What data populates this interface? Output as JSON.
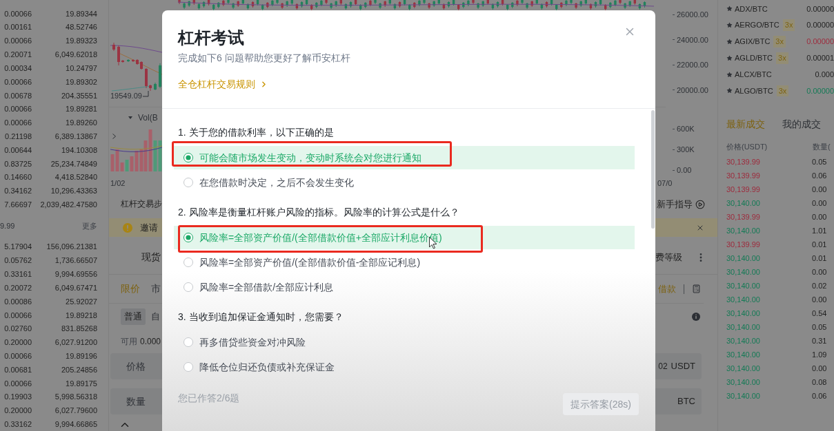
{
  "order_book": {
    "asks": [
      {
        "amount": "0.00066",
        "total": "19.89344"
      },
      {
        "amount": "0.00161",
        "total": "48.52746"
      },
      {
        "amount": "0.00066",
        "total": "19.89323"
      },
      {
        "amount": "0.20071",
        "total": "6,049.62018"
      },
      {
        "amount": "0.00034",
        "total": "10.24797"
      },
      {
        "amount": "0.00066",
        "total": "19.89302"
      },
      {
        "amount": "0.00678",
        "total": "204.35551"
      },
      {
        "amount": "0.00066",
        "total": "19.89281"
      },
      {
        "amount": "0.00066",
        "total": "19.89260"
      },
      {
        "amount": "0.21198",
        "total": "6,389.13867"
      },
      {
        "amount": "0.00644",
        "total": "194.10308"
      },
      {
        "amount": "0.83725",
        "total": "25,234.74849"
      },
      {
        "amount": "0.14660",
        "total": "4,418.52840"
      },
      {
        "amount": "0.34162",
        "total": "10,296.43363"
      },
      {
        "amount": "7.66697",
        "total": "2,039,482.47580"
      }
    ],
    "mid": {
      "price": "9.99",
      "more": "更多"
    },
    "bids": [
      {
        "amount": "5.17904",
        "total": "156,096.21381"
      },
      {
        "amount": "0.05762",
        "total": "1,736.66507"
      },
      {
        "amount": "0.33161",
        "total": "9,994.69556"
      },
      {
        "amount": "0.20072",
        "total": "6,049.67471"
      },
      {
        "amount": "0.00086",
        "total": "25.92027"
      },
      {
        "amount": "0.00066",
        "total": "19.89218"
      },
      {
        "amount": "0.02760",
        "total": "831.85268"
      },
      {
        "amount": "0.20000",
        "total": "6,027.91200"
      },
      {
        "amount": "0.00066",
        "total": "19.89196"
      },
      {
        "amount": "0.00681",
        "total": "205.24856"
      },
      {
        "amount": "0.00066",
        "total": "19.89175"
      },
      {
        "amount": "0.19903",
        "total": "5,998.56318"
      },
      {
        "amount": "0.20000",
        "total": "6,027.79600"
      },
      {
        "amount": "0.33162",
        "total": "9,994.66865"
      }
    ]
  },
  "chart": {
    "low_label": "19549.09",
    "volume_title": "Vol(B",
    "price_axis": [
      "26000.00",
      "24000.00",
      "22000.00",
      "20000.00"
    ],
    "volume_axis": [
      "600K",
      "300K",
      "0.00"
    ],
    "dates": [
      "1/02",
      "07/0"
    ]
  },
  "trade_panel": {
    "guide_title": "杠杆交易步",
    "guide_link": "新手指导",
    "notice": "邀请",
    "account_tab": "现货",
    "fee_link": "费等级",
    "order_types": [
      {
        "label": "限价",
        "selected": true
      },
      {
        "label": "市",
        "selected": false
      }
    ],
    "borrow_link": "借款",
    "modes": [
      {
        "label": "普通",
        "selected": true
      },
      {
        "label": "自",
        "selected": false
      }
    ],
    "available_label": "可用",
    "available_value": "0.000",
    "price_field": {
      "label": "价格",
      "value": "02",
      "unit": "USDT"
    },
    "amount_field": {
      "label": "数量",
      "unit": "BTC"
    }
  },
  "market_list": [
    {
      "pair": "ADX/BTC",
      "price": "0.00000",
      "color": "#1f1f1f"
    },
    {
      "pair": "AERGO/BTC",
      "leverage": "3x",
      "price": "0.00000",
      "color": "#1f1f1f"
    },
    {
      "pair": "AGIX/BTC",
      "leverage": "3x",
      "price": "0.00000",
      "color": "#9e2a3c"
    },
    {
      "pair": "AGLD/BTC",
      "leverage": "3x",
      "price": "0.00001",
      "color": "#1f1f1f"
    },
    {
      "pair": "ALCX/BTC",
      "price": "0.000",
      "color": "#1f1f1f"
    },
    {
      "pair": "ALGO/BTC",
      "leverage": "3x",
      "price": "0.00000",
      "color": "#137a55"
    }
  ],
  "trades": {
    "tabs": [
      {
        "label": "最新成交",
        "selected": true
      },
      {
        "label": "我的成交",
        "selected": false
      }
    ],
    "columns": [
      "价格(USDT)",
      "数量("
    ],
    "rows": [
      {
        "price": "30,139.99",
        "amount": "0.05",
        "color": "#9e2a3c"
      },
      {
        "price": "30,139.99",
        "amount": "0.06",
        "color": "#9e2a3c"
      },
      {
        "price": "30,139.99",
        "amount": "0.00",
        "color": "#9e2a3c"
      },
      {
        "price": "30,140.00",
        "amount": "0.00",
        "color": "#137a55"
      },
      {
        "price": "30,139.99",
        "amount": "0.00",
        "color": "#9e2a3c"
      },
      {
        "price": "30,140.00",
        "amount": "1.01",
        "color": "#137a55"
      },
      {
        "price": "30,139.99",
        "amount": "0.01",
        "color": "#9e2a3c"
      },
      {
        "price": "30,140.00",
        "amount": "0.01",
        "color": "#137a55"
      },
      {
        "price": "30,140.00",
        "amount": "0.00",
        "color": "#137a55"
      },
      {
        "price": "30,140.00",
        "amount": "0.02",
        "color": "#137a55"
      },
      {
        "price": "30,140.00",
        "amount": "0.00",
        "color": "#137a55"
      },
      {
        "price": "30,140.00",
        "amount": "0.54",
        "color": "#137a55"
      },
      {
        "price": "30,140.00",
        "amount": "0.05",
        "color": "#137a55"
      },
      {
        "price": "30,140.00",
        "amount": "0.31",
        "color": "#137a55"
      },
      {
        "price": "30,140.00",
        "amount": "1.09",
        "color": "#137a55"
      },
      {
        "price": "30,140.00",
        "amount": "0.00",
        "color": "#137a55"
      },
      {
        "price": "30,140.00",
        "amount": "0.08",
        "color": "#137a55"
      },
      {
        "price": "30,140.00",
        "amount": "0.06",
        "color": "#137a55"
      }
    ]
  },
  "dialog": {
    "title": "杠杆考试",
    "subtitle": "完成如下6 问题帮助您更好了解币安杠杆",
    "rules_link": "全仓杠杆交易规则",
    "questions": [
      {
        "text": "1. 关于您的借款利率，以下正确的是",
        "options": [
          {
            "text": "可能会随市场发生变动，变动时系统会对您进行通知",
            "selected": true
          },
          {
            "text": "在您借款时决定，之后不会发生变化",
            "selected": false
          }
        ]
      },
      {
        "text": "2. 风险率是衡量杠杆账户风险的指标。风险率的计算公式是什么？",
        "options": [
          {
            "text": "风险率=全部资产价值/(全部借款价值+全部应计利息价值)",
            "selected": true
          },
          {
            "text": "风险率=全部资产价值/(全部借款价值-全部应记利息)",
            "selected": false
          },
          {
            "text": "风险率=全部借款/全部应计利息",
            "selected": false
          }
        ]
      },
      {
        "text": "3. 当收到追加保证金通知时，您需要？",
        "options": [
          {
            "text": "再多借贷些资金对冲风险",
            "selected": false
          },
          {
            "text": "降低仓位归还负债或补充保证金",
            "selected": false
          }
        ]
      }
    ],
    "progress": "您已作答2/6题",
    "hint_button": {
      "label": "提示答案(28s)",
      "disabled": true
    }
  }
}
